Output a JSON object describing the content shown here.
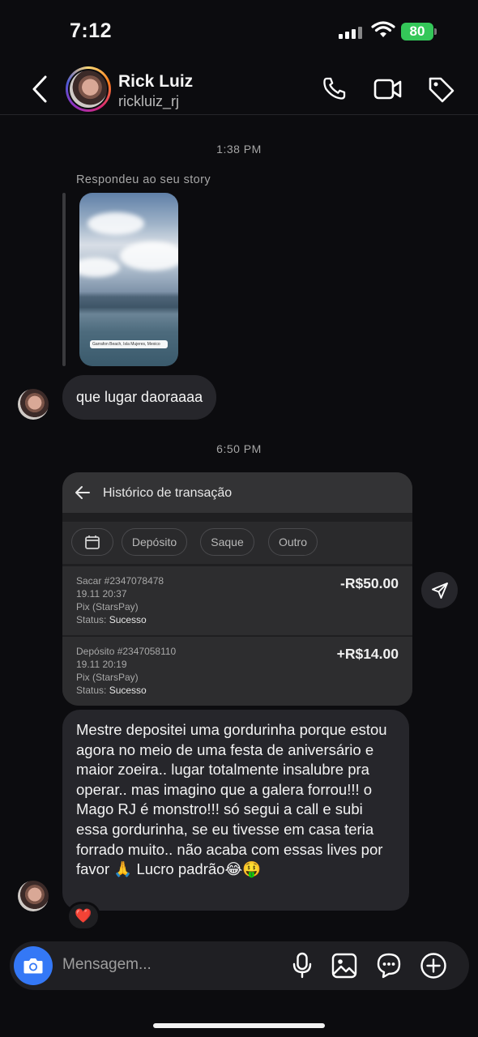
{
  "status_bar": {
    "time": "7:12",
    "battery": "80"
  },
  "header": {
    "name": "Rick Luiz",
    "username": "rickluiz_rj",
    "icons": [
      "back-arrow-icon",
      "phone-icon",
      "video-camera-icon",
      "tag-icon"
    ]
  },
  "chat": {
    "timestamp_1": "1:38 PM",
    "story_reply_caption": "Respondeu ao seu story",
    "story_location": "Garrafon Beach, Isla Mujeres, Mexico",
    "message_1": "que lugar daoraaaa",
    "timestamp_2": "6:50 PM",
    "transaction_card": {
      "title": "Histórico de transação",
      "filters": [
        "Depósito",
        "Saque",
        "Outro"
      ],
      "transactions": [
        {
          "id_line": "Sacar #2347078478",
          "date": "19.11 20:37",
          "method": "Pix (StarsPay)",
          "status_label": "Status:",
          "status": "Sucesso",
          "amount": "-R$50.00"
        },
        {
          "id_line": "Depósito #2347058110",
          "date": "19.11 20:19",
          "method": "Pix (StarsPay)",
          "status_label": "Status:",
          "status": "Sucesso",
          "amount": "+R$14.00"
        }
      ]
    },
    "message_2": "Mestre depositei uma gordurinha porque estou agora no meio de uma festa de aniversário e maior zoeira.. lugar totalmente insalubre pra operar.. mas imagino que a galera forrou!!! o Mago RJ é monstro!!! só segui a call e subi essa gordurinha, se eu tivesse em casa teria forrado muito.. não acaba com essas lives por favor 🙏 Lucro padrão😂🤑",
    "reaction": "❤️"
  },
  "composer": {
    "placeholder": "Mensagem...",
    "icons": [
      "camera-icon",
      "microphone-icon",
      "gallery-icon",
      "sticker-icon",
      "plus-icon"
    ]
  },
  "colors": {
    "background": "#0c0c0f",
    "bubble": "#26262b",
    "camera_button": "#3478f6",
    "battery": "#34c759"
  }
}
